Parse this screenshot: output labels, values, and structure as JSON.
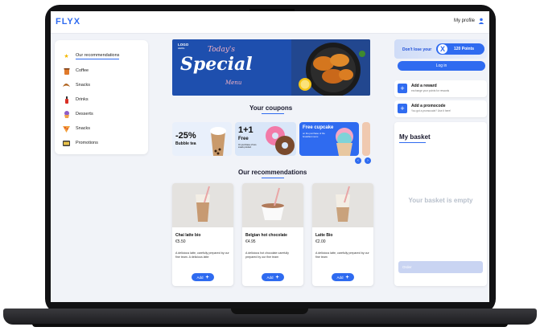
{
  "app": {
    "logo": "FLYX",
    "profile_label": "My profile"
  },
  "sidebar": {
    "items": [
      {
        "label": "Our recommendations",
        "icon": "star-icon",
        "active": true
      },
      {
        "label": "Coffee",
        "icon": "coffee-cup-icon"
      },
      {
        "label": "Snacks",
        "icon": "croissant-icon"
      },
      {
        "label": "Drinks",
        "icon": "bottle-icon"
      },
      {
        "label": "Desserts",
        "icon": "cupcake-icon"
      },
      {
        "label": "Snacks",
        "icon": "pizza-slice-icon"
      },
      {
        "label": "Promotions",
        "icon": "ticket-icon"
      }
    ]
  },
  "banner": {
    "logo": "LOGO",
    "logo_sub": "HERE",
    "pre_title": "Today's",
    "title": "Special",
    "subtitle": "Menu"
  },
  "coupons": {
    "title": "Your coupons",
    "items": [
      {
        "headline": "-25%",
        "sub": "Bubble tea",
        "bg": "#e9f0fb"
      },
      {
        "headline": "1+1",
        "sub": "Free",
        "small": "On purchase of two snack product",
        "bg": "#d9e6f8"
      },
      {
        "headline": "Free cupcake",
        "small": "on the purchase of the breakfast menu",
        "bg": "#2f6bf0"
      }
    ]
  },
  "recommendations": {
    "title": "Our recommendations",
    "items": [
      {
        "name": "Chai latte bio",
        "price": "€5.50",
        "desc": "A delicious latte, carefully prepared by our fine team. A delicious latte",
        "add": "Add"
      },
      {
        "name": "Belgian hot chocolate",
        "price": "€4.95",
        "desc": "A delicious hot chocolate carefully prepared by our fine team",
        "add": "Add"
      },
      {
        "name": "Latte Bio",
        "price": "€2.00",
        "desc": "A delicious latte, carefully prepared by our fine team",
        "add": "Add"
      }
    ]
  },
  "points_box": {
    "tagline": "Don't lose your",
    "badge_letter": "X",
    "points": "120 Points",
    "login": "Log in"
  },
  "actions": [
    {
      "title": "Add a reward",
      "sub": "exchange your points for rewards"
    },
    {
      "title": "Add a promocode",
      "sub": "You got a promocode? Use it here!"
    }
  ],
  "basket": {
    "title": "My basket",
    "empty": "Your basket is empty",
    "order": "Order"
  },
  "colors": {
    "accent": "#2f6bf0",
    "background": "#f1f3f8"
  }
}
